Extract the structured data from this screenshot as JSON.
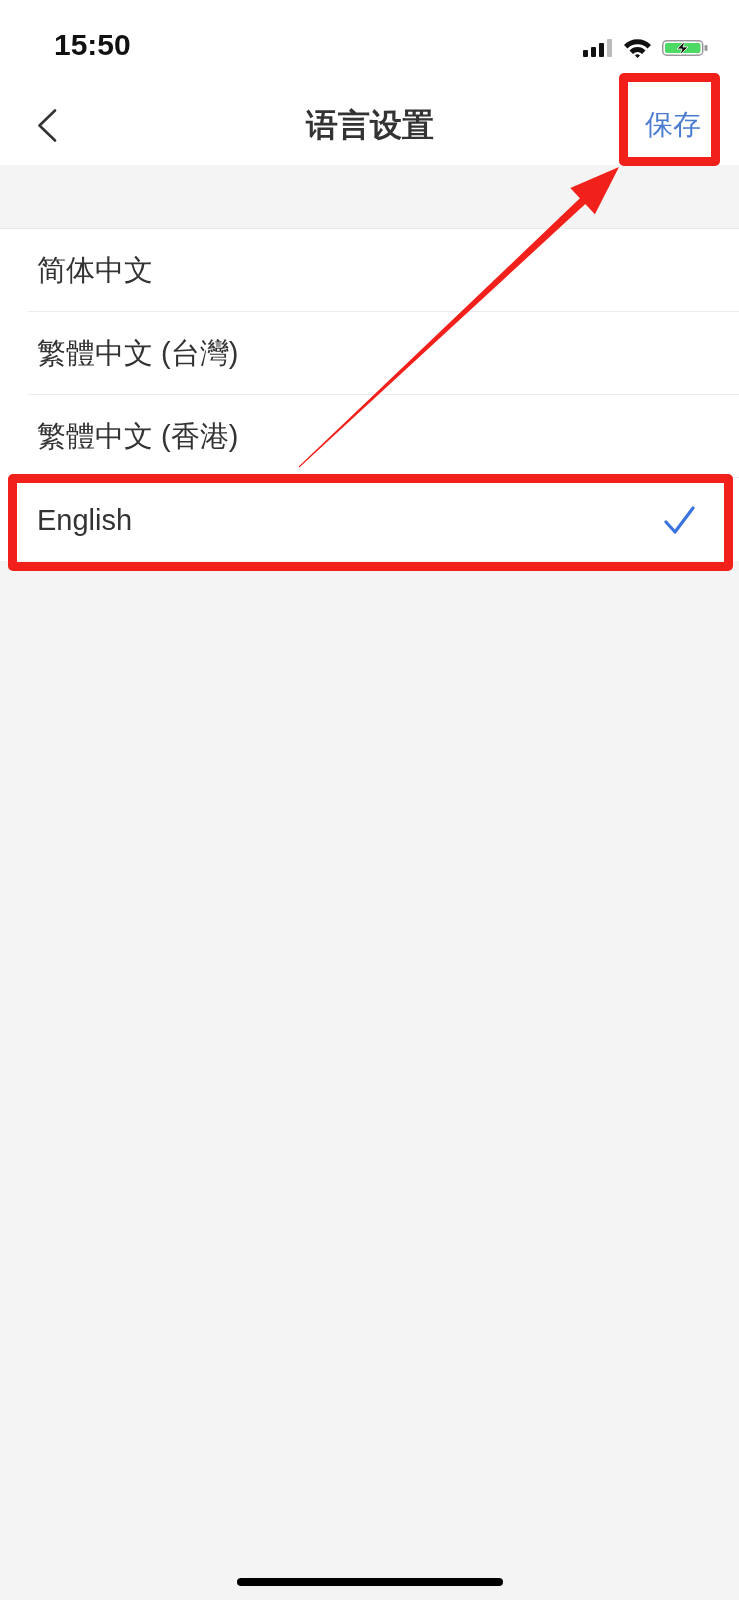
{
  "status_bar": {
    "time": "15:50"
  },
  "nav_bar": {
    "title": "语言设置",
    "save_label": "保存",
    "save_highlighted": true
  },
  "languages": [
    {
      "label": "简体中文",
      "selected": false,
      "highlighted": false
    },
    {
      "label": "繁體中文 (台灣)",
      "selected": false,
      "highlighted": false
    },
    {
      "label": "繁體中文 (香港)",
      "selected": false,
      "highlighted": false
    },
    {
      "label": "English",
      "selected": true,
      "highlighted": true
    }
  ]
}
